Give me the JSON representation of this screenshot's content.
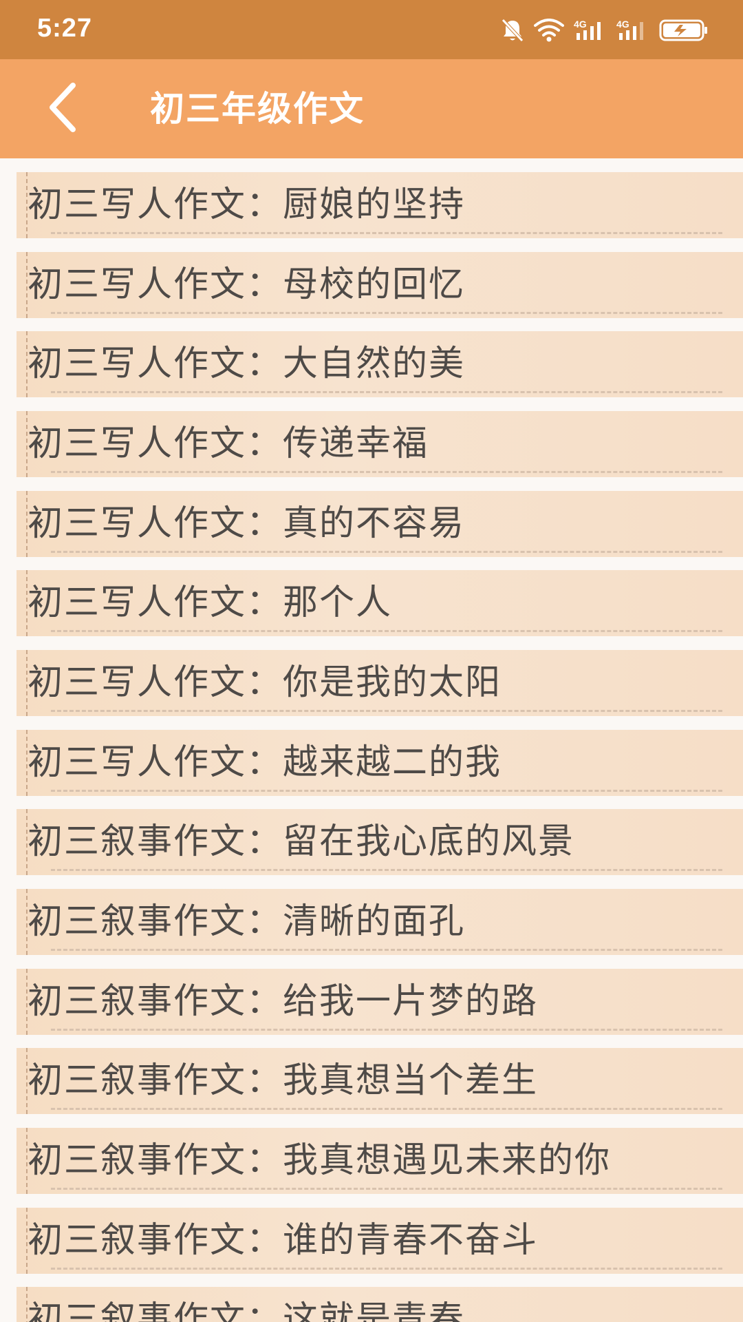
{
  "status_bar": {
    "time": "5:27",
    "icons": [
      "bell-muted-icon",
      "wifi-icon",
      "signal-4g-icon",
      "signal-4g-icon",
      "battery-charging-icon"
    ],
    "network_label_1": "4G",
    "network_label_2": "4G"
  },
  "app_bar": {
    "back_icon": "chevron-left-icon",
    "title": "初三年级作文"
  },
  "colors": {
    "status_bar": "#cf853f",
    "app_bar": "#f3a464",
    "item_background": "#f6ddc3",
    "item_text": "#4e4a47"
  },
  "articles": [
    {
      "label": "初三写人作文：厨娘的坚持"
    },
    {
      "label": "初三写人作文：母校的回忆"
    },
    {
      "label": "初三写人作文：大自然的美"
    },
    {
      "label": "初三写人作文：传递幸福"
    },
    {
      "label": "初三写人作文：真的不容易"
    },
    {
      "label": "初三写人作文：那个人"
    },
    {
      "label": "初三写人作文：你是我的太阳"
    },
    {
      "label": "初三写人作文：越来越二的我"
    },
    {
      "label": "初三叙事作文：留在我心底的风景"
    },
    {
      "label": "初三叙事作文：清晰的面孔"
    },
    {
      "label": "初三叙事作文：给我一片梦的路"
    },
    {
      "label": "初三叙事作文：我真想当个差生"
    },
    {
      "label": "初三叙事作文：我真想遇见未来的你"
    },
    {
      "label": "初三叙事作文：谁的青春不奋斗"
    },
    {
      "label": "初三叙事作文：这就是青春"
    }
  ]
}
